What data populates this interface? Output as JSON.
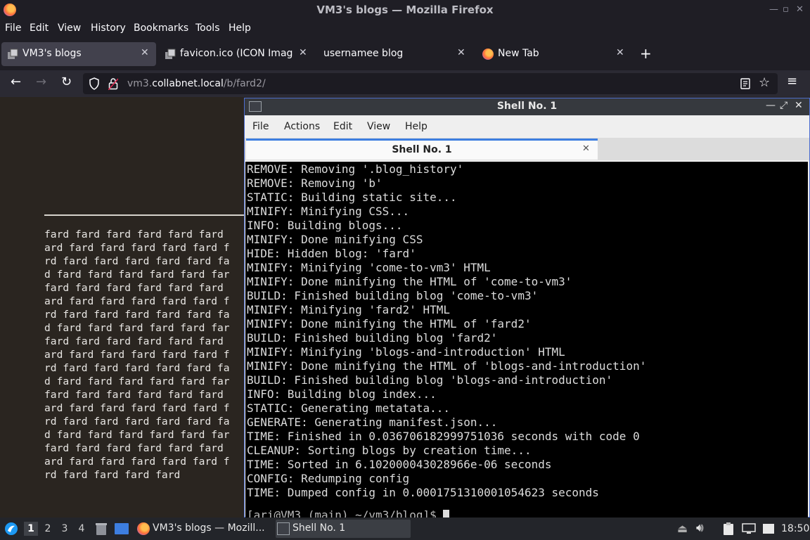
{
  "firefox": {
    "window_title": "VM3's blogs — Mozilla Firefox",
    "menu": [
      "File",
      "Edit",
      "View",
      "History",
      "Bookmarks",
      "Tools",
      "Help"
    ],
    "tabs": [
      {
        "label": "VM3's blogs",
        "active": true
      },
      {
        "label": "favicon.ico (ICON Image,",
        "active": false
      },
      {
        "label": "usernamee blog",
        "active": false
      },
      {
        "label": "New Tab",
        "active": false
      }
    ],
    "url": {
      "prefix": "vm3.",
      "domain": "collabnet.local",
      "path": "/b/fard2/"
    }
  },
  "page": {
    "lines": [
      "fard fard fard fard fard fard",
      "ard fard fard fard fard fard f",
      "rd fard fard fard fard fard fa",
      "d fard fard fard fard fard far",
      "fard fard fard fard fard fard",
      "ard fard fard fard fard fard f",
      "rd fard fard fard fard fard fa",
      "d fard fard fard fard fard far",
      "fard fard fard fard fard fard",
      "ard fard fard fard fard fard f",
      "rd fard fard fard fard fard fa",
      "d fard fard fard fard fard far",
      "fard fard fard fard fard fard",
      "ard fard fard fard fard fard f",
      "rd fard fard fard fard fard fa",
      "d fard fard fard fard fard far",
      "fard fard fard fard fard fard",
      "ard fard fard fard fard fard f",
      "rd fard fard fard fard"
    ]
  },
  "terminal": {
    "window_title": "Shell No. 1",
    "menu": [
      "File",
      "Actions",
      "Edit",
      "View",
      "Help"
    ],
    "tab_label": "Shell No. 1",
    "lines": [
      "REMOVE: Removing '.blog_history'",
      "REMOVE: Removing 'b'",
      "STATIC: Building static site...",
      "MINIFY: Minifying CSS...",
      "INFO: Building blogs...",
      "MINIFY: Done minifying CSS",
      "HIDE: Hidden blog: 'fard'",
      "MINIFY: Minifying 'come-to-vm3' HTML",
      "MINIFY: Done minifying the HTML of 'come-to-vm3'",
      "BUILD: Finished building blog 'come-to-vm3'",
      "MINIFY: Minifying 'fard2' HTML",
      "MINIFY: Done minifying the HTML of 'fard2'",
      "BUILD: Finished building blog 'fard2'",
      "MINIFY: Minifying 'blogs-and-introduction' HTML",
      "MINIFY: Done minifying the HTML of 'blogs-and-introduction'",
      "BUILD: Finished building blog 'blogs-and-introduction'",
      "INFO: Building blog index...",
      "STATIC: Generating metatata...",
      "GENERATE: Generating manifest.json...",
      "TIME: Finished in 0.036706182999751036 seconds with code 0",
      "CLEANUP: Sorting blogs by creation time...",
      "TIME: Sorted in 6.102000043028966e-06 seconds",
      "CONFIG: Redumping config",
      "TIME: Dumped config in 0.0001751310001054623 seconds"
    ],
    "prompt_partial": "[ari@VM3 (main) ~/vm3/blog]$ "
  },
  "taskbar": {
    "workspaces": [
      "1",
      "2",
      "3",
      "4"
    ],
    "active_workspace": "1",
    "tasks": [
      {
        "label": "VM3's blogs — Mozill...",
        "active": false
      },
      {
        "label": "Shell No. 1",
        "active": true
      }
    ],
    "clock": "18:50"
  },
  "colors": {
    "firefox_accent": "#ff7139",
    "terminal_tab_accent": "#3d7ee0",
    "terminal_window_border": "#4d6ed1"
  }
}
